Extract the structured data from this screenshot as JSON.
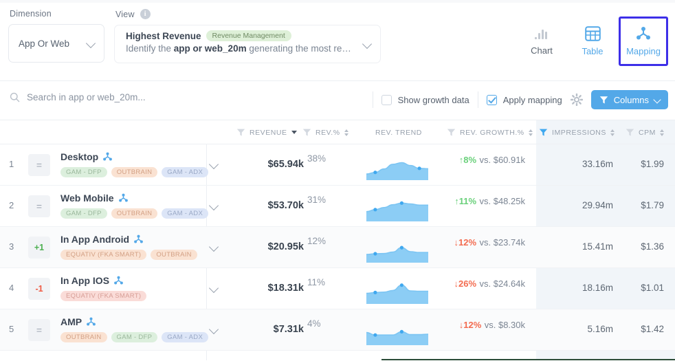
{
  "controls": {
    "dimension_label": "Dimension",
    "dimension_value": "App Or Web",
    "view_label": "View",
    "view_title": "Highest Revenue",
    "view_badge": "Revenue Management",
    "view_desc_pre": "Identify the ",
    "view_desc_bold": "app or web_20m",
    "view_desc_post": " generating the most re…"
  },
  "viewmodes": [
    {
      "label": "Chart",
      "icon": "bar-chart-icon",
      "state": "inactive"
    },
    {
      "label": "Table",
      "icon": "table-grid-icon",
      "state": "active"
    },
    {
      "label": "Mapping",
      "icon": "mapping-node-icon",
      "state": "selected"
    }
  ],
  "search": {
    "placeholder": "Search in app or web_20m...",
    "icon": "search-icon"
  },
  "filters": {
    "growth_checkbox_label": "Show growth data",
    "growth_checked": false,
    "mapping_checkbox_label": "Apply mapping",
    "mapping_checked": true,
    "gear_icon": "gear-icon",
    "columns_button": "Columns"
  },
  "columns": [
    {
      "key": "revenue",
      "label": "REVENUE",
      "filter": true,
      "filter_active": false,
      "sort": "desc"
    },
    {
      "key": "revpct",
      "label": "REV.%",
      "filter": true,
      "filter_active": false,
      "sort": "both"
    },
    {
      "key": "trend",
      "label": "REV. TREND",
      "filter": false,
      "filter_active": false,
      "sort": "none"
    },
    {
      "key": "growth",
      "label": "REV. GROWTH.%",
      "filter": true,
      "filter_active": false,
      "sort": "both"
    },
    {
      "key": "impr",
      "label": "IMPRESSIONS",
      "filter": true,
      "filter_active": true,
      "sort": "both"
    },
    {
      "key": "cpm",
      "label": "CPM",
      "filter": true,
      "filter_active": false,
      "sort": "both"
    }
  ],
  "rows": [
    {
      "rank": "1",
      "delta": "=",
      "delta_type": "eq",
      "name": "Desktop",
      "tags": [
        {
          "text": "GAM - DFP",
          "color": "green"
        },
        {
          "text": "OUTBRAIN",
          "color": "peach"
        },
        {
          "text": "GAM - ADX",
          "color": "lav"
        }
      ],
      "revenue": "$65.94k",
      "rev_pct": "38%",
      "rev_pct_value": 38,
      "growth": "+8%",
      "growth_dir": "pos",
      "growth_vs": "vs. $60.91k",
      "impressions": "33.16m",
      "cpm": "$1.99",
      "trend": [
        30,
        38,
        55,
        78,
        86,
        72,
        58,
        56
      ],
      "trend_points": [
        1,
        6
      ]
    },
    {
      "rank": "2",
      "delta": "=",
      "delta_type": "eq",
      "name": "Web Mobile",
      "tags": [
        {
          "text": "GAM - DFP",
          "color": "green"
        },
        {
          "text": "OUTBRAIN",
          "color": "peach"
        },
        {
          "text": "GAM - ADX",
          "color": "lav"
        }
      ],
      "revenue": "$53.70k",
      "rev_pct": "31%",
      "rev_pct_value": 31,
      "growth": "+11%",
      "growth_dir": "pos",
      "growth_vs": "vs. $48.25k",
      "impressions": "29.94m",
      "cpm": "$1.79",
      "trend": [
        48,
        58,
        68,
        82,
        90,
        86,
        80,
        80
      ],
      "trend_points": [
        1,
        4
      ]
    },
    {
      "rank": "3",
      "delta": "+1",
      "delta_type": "up",
      "name": "In App Android",
      "tags": [
        {
          "text": "EQUATIV (FKA SMART)",
          "color": "peach"
        },
        {
          "text": "OUTBRAIN",
          "color": "peach"
        }
      ],
      "revenue": "$20.95k",
      "rev_pct": "12%",
      "rev_pct_value": 12,
      "growth": "-12%",
      "growth_dir": "neg",
      "growth_vs": "vs. $23.74k",
      "impressions": "15.41m",
      "cpm": "$1.36",
      "trend": [
        40,
        44,
        45,
        52,
        74,
        54,
        50,
        50
      ],
      "trend_points": [
        1,
        4
      ]
    },
    {
      "rank": "4",
      "delta": "-1",
      "delta_type": "down",
      "name": "In App IOS",
      "tags": [
        {
          "text": "EQUATIV (FKA SMART)",
          "color": "pink"
        }
      ],
      "revenue": "$18.31k",
      "rev_pct": "11%",
      "rev_pct_value": 11,
      "growth": "-26%",
      "growth_dir": "neg",
      "growth_vs": "vs. $24.64k",
      "impressions": "18.16m",
      "cpm": "$1.01",
      "trend": [
        52,
        56,
        58,
        66,
        92,
        64,
        62,
        62
      ],
      "trend_points": [
        1,
        4
      ]
    },
    {
      "rank": "5",
      "delta": "=",
      "delta_type": "eq",
      "name": "AMP",
      "tags": [
        {
          "text": "OUTBRAIN",
          "color": "peach"
        },
        {
          "text": "GAM - DFP",
          "color": "green"
        },
        {
          "text": "GAM - ADX",
          "color": "lav"
        }
      ],
      "revenue": "$7.31k",
      "rev_pct": "4%",
      "rev_pct_value": 4,
      "growth": "-12%",
      "growth_dir": "neg",
      "growth_vs": "vs. $8.30k",
      "impressions": "5.16m",
      "cpm": "$1.42",
      "trend": [
        62,
        50,
        50,
        50,
        66,
        52,
        52,
        54
      ],
      "trend_points": [
        1,
        4
      ]
    }
  ],
  "colors": {
    "accent_blue": "#53a8e8",
    "selection_purple": "#3d2fe8",
    "positive_green": "#69d07a",
    "negative_red": "#f36b4f",
    "bar_fill": "#3fa8ef"
  }
}
